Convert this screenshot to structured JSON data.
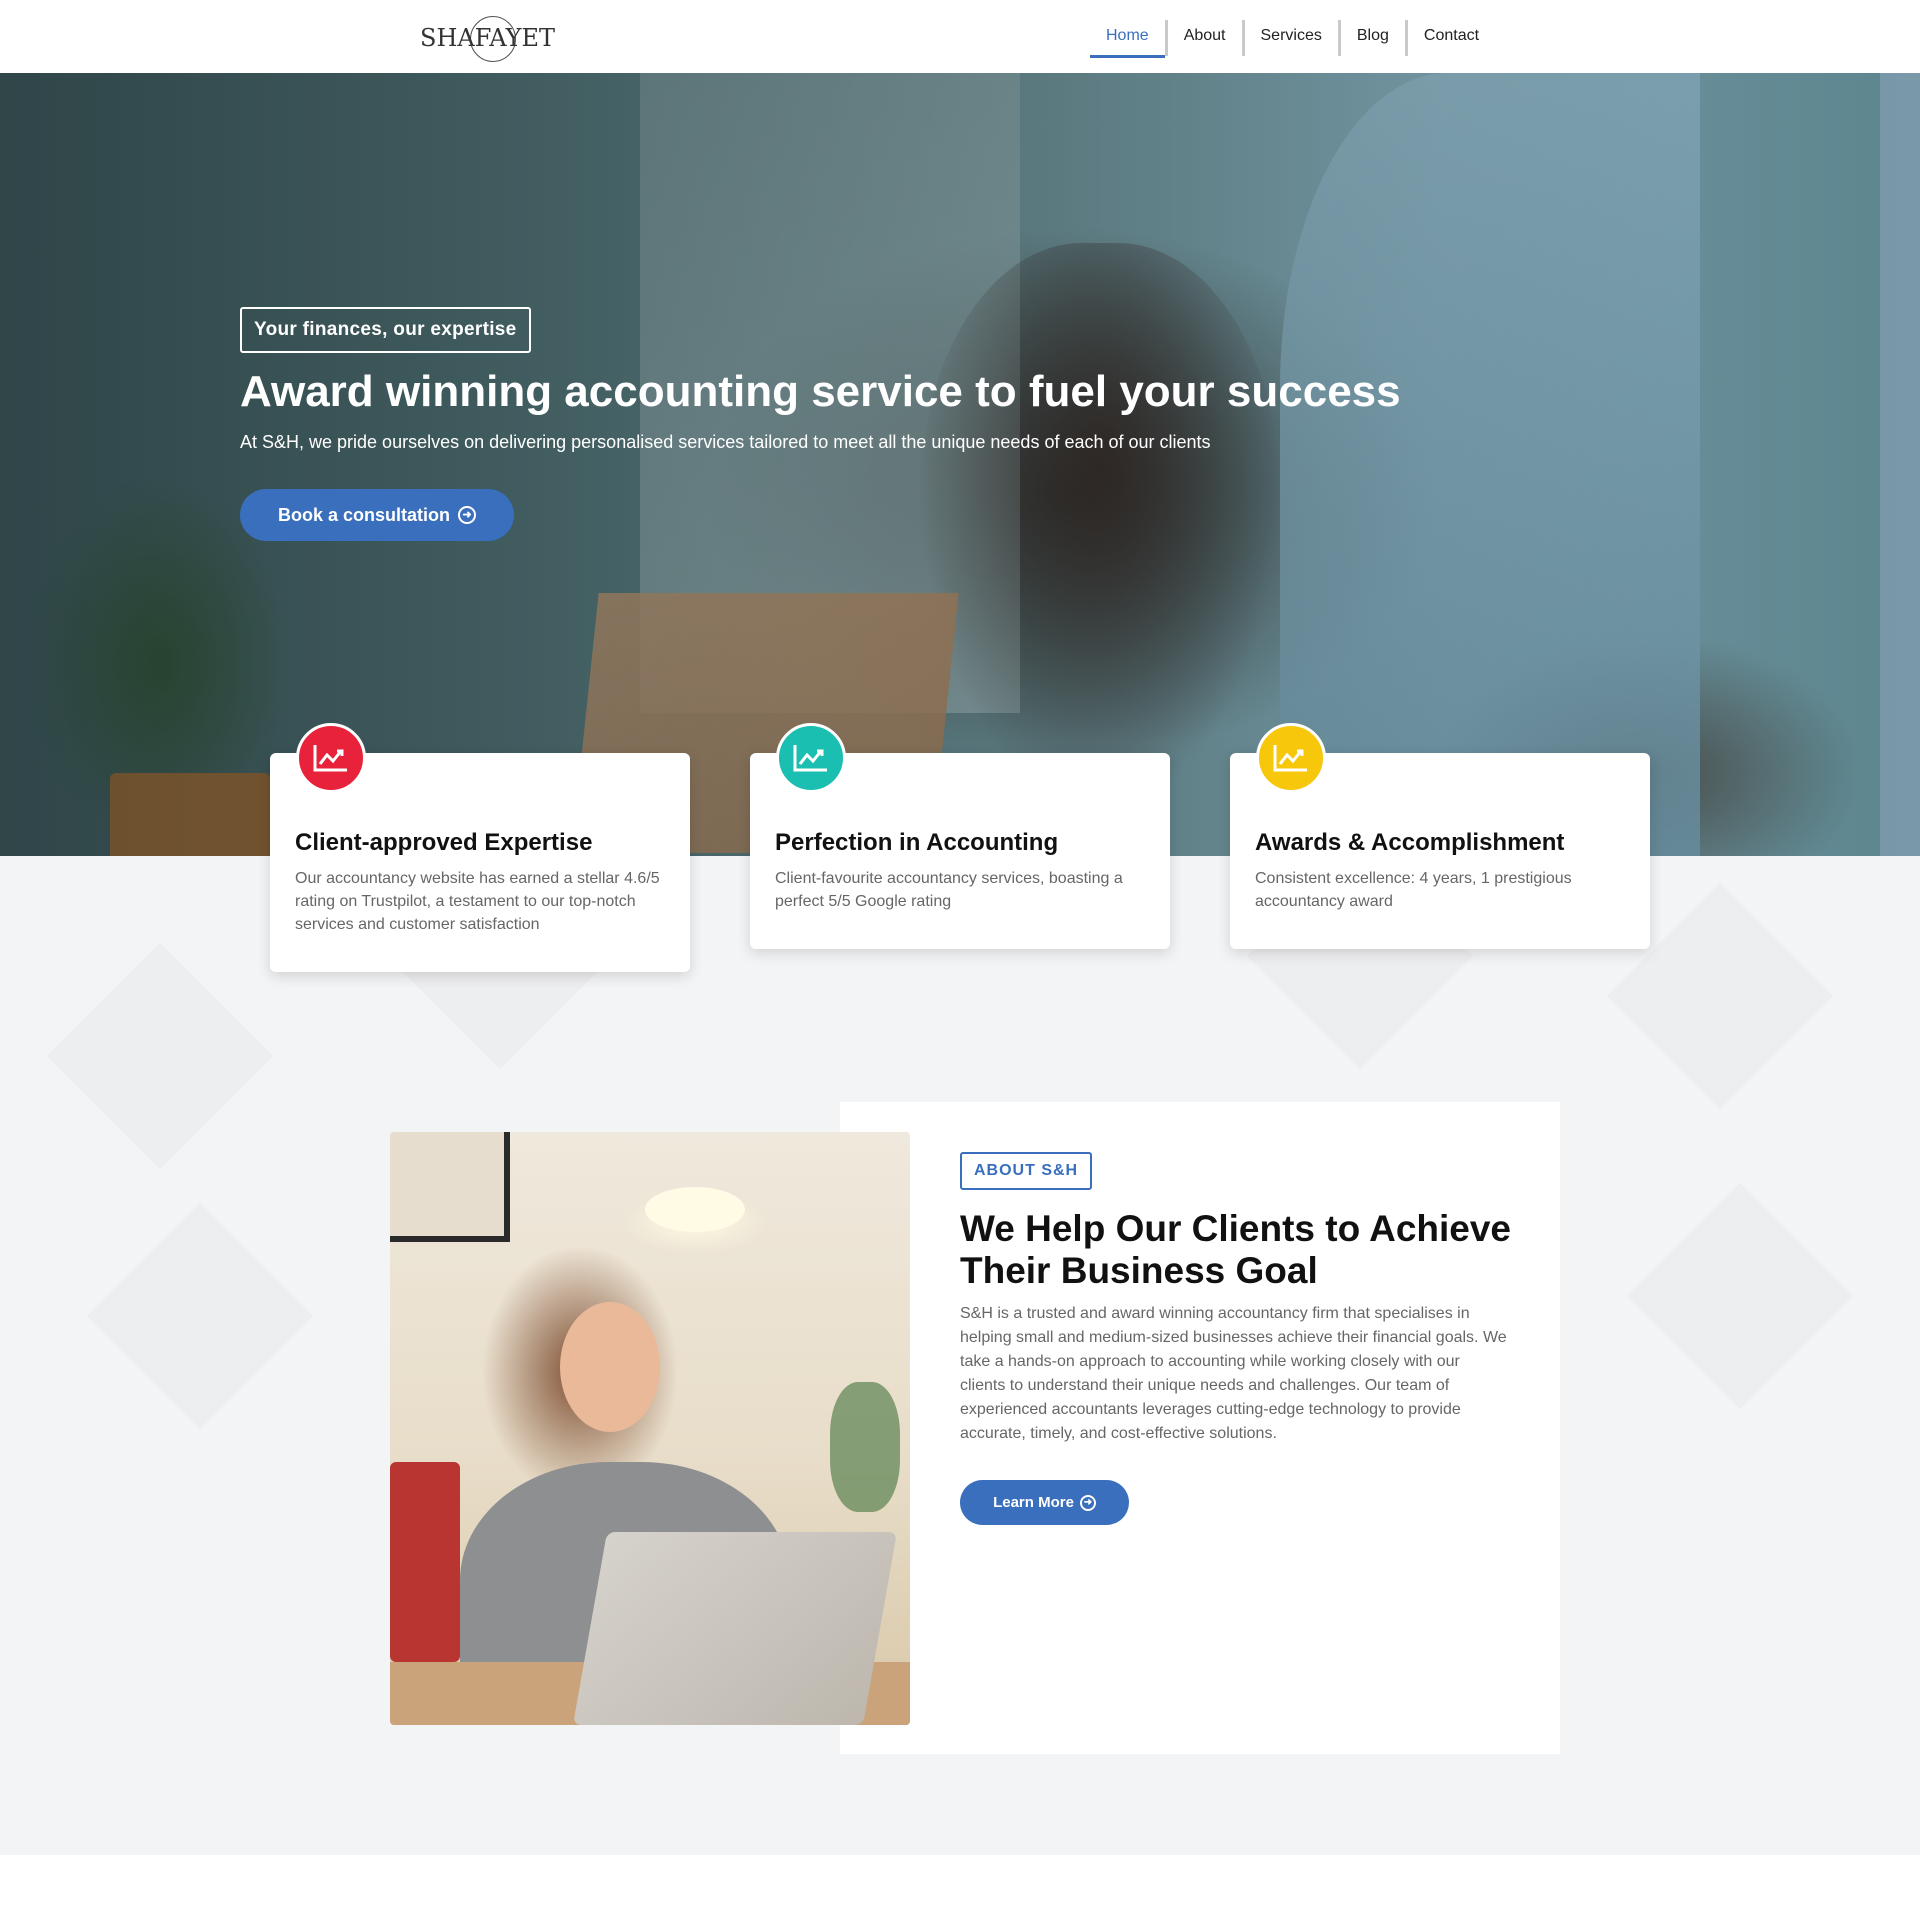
{
  "header": {
    "logo_text": "SHAFAYET",
    "nav": [
      "Home",
      "About",
      "Services",
      "Blog",
      "Contact"
    ],
    "active": "Home"
  },
  "hero": {
    "badge": "Your finances, our expertise",
    "title": "Award winning accounting service to fuel your success",
    "subtitle": "At S&H, we pride ourselves on delivering personalised services tailored to meet all the unique needs of each of our clients",
    "cta_label": "Book a consultation"
  },
  "features": [
    {
      "title": "Client-approved Expertise",
      "text": "Our accountancy website has earned a stellar 4.6/5 rating on Trustpilot, a testament to our top-notch services and customer satisfaction",
      "icon": "chart-icon",
      "color": "#e8223a"
    },
    {
      "title": "Perfection in Accounting",
      "text": "Client-favourite accountancy services, boasting a perfect 5/5 Google rating",
      "icon": "chart-icon",
      "color": "#1bbfb1"
    },
    {
      "title": "Awards & Accomplishment",
      "text": "Consistent excellence: 4 years, 1 prestigious accountancy award",
      "icon": "chart-icon",
      "color": "#f6c70a"
    }
  ],
  "about": {
    "badge": "ABOUT S&H",
    "title": "We Help Our Clients to Achieve Their Business Goal",
    "text": "S&H is a trusted and award winning accountancy firm that specialises in helping small and medium-sized businesses achieve their financial goals. We take a hands-on approach to accounting while working closely with our clients to understand their unique needs and challenges. Our team of experienced accountants leverages cutting-edge technology to provide accurate, timely, and cost-effective solutions.",
    "cta_label": "Learn More"
  },
  "colors": {
    "accent": "#3a6fbd"
  }
}
